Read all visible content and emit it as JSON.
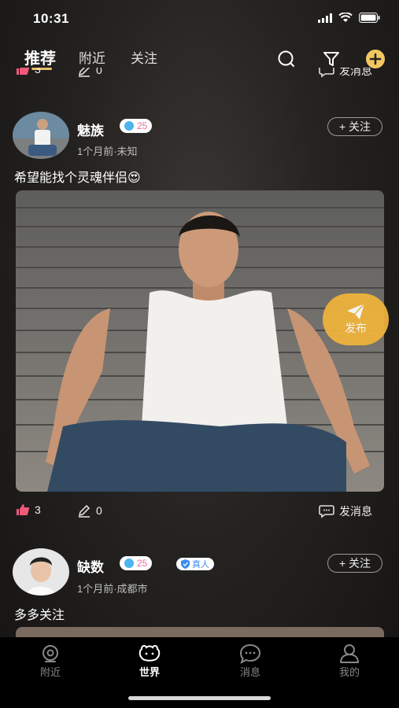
{
  "status": {
    "time": "10:31"
  },
  "top_tabs": [
    {
      "label": "推荐",
      "active": true
    },
    {
      "label": "附近",
      "active": false
    },
    {
      "label": "关注",
      "active": false
    }
  ],
  "prev_post": {
    "likes": "3",
    "comments": "0",
    "message_label": "发消息"
  },
  "posts": [
    {
      "username": "魅族",
      "level": "25",
      "time_location": "1个月前·未知",
      "follow_label": "+ 关注",
      "text": "希望能找个灵魂伴侣😍",
      "likes": "3",
      "comments": "0",
      "message_label": "发消息"
    },
    {
      "username": "缺数",
      "level": "25",
      "verified_label": "真人",
      "time_location": "1个月前·成都市",
      "follow_label": "+ 关注",
      "text": "多多关注"
    }
  ],
  "fab": {
    "label": "发布"
  },
  "bottom_tabs": [
    {
      "label": "附近",
      "icon": "nearby-icon",
      "active": false
    },
    {
      "label": "世界",
      "icon": "world-icon",
      "active": true
    },
    {
      "label": "消息",
      "icon": "message-icon",
      "active": false
    },
    {
      "label": "我的",
      "icon": "profile-icon",
      "active": false
    }
  ],
  "colors": {
    "accent": "#e9c069",
    "fab": "#f0b43a",
    "like": "#f05a7a",
    "level": "#4cb4ee",
    "verified": "#3b8bf0"
  }
}
